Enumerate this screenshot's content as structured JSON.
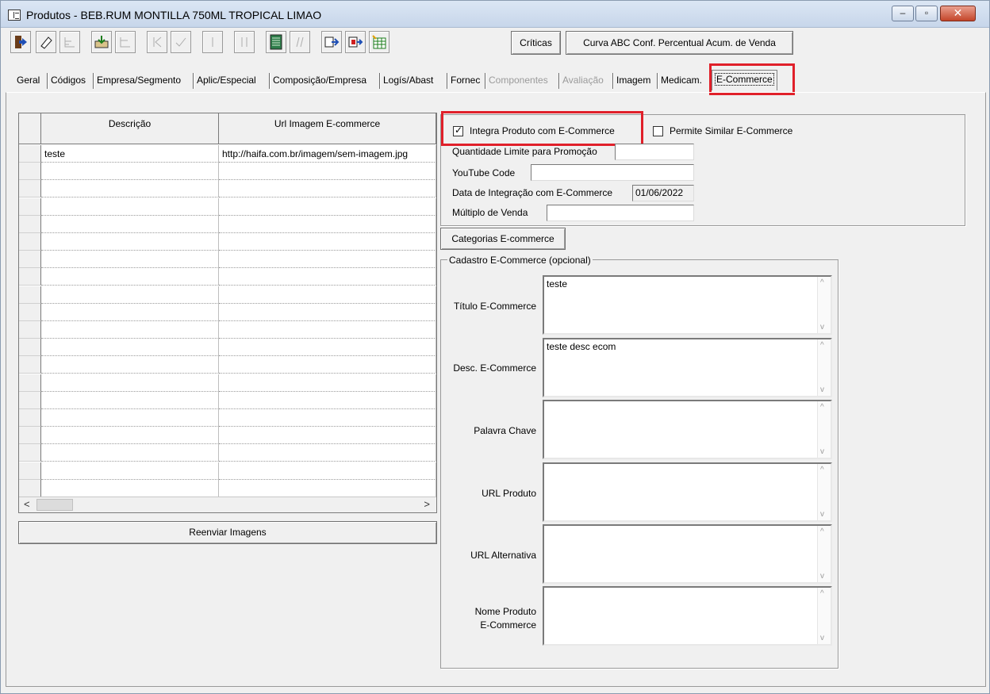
{
  "window": {
    "title": "Produtos - BEB.RUM MONTILLA 750ML TROPICAL LIMAO",
    "controls": {
      "minimize": "–",
      "maximize": "▫",
      "close": "✕"
    }
  },
  "toolbar": {
    "icons": [
      "exit-icon",
      "eraser-icon",
      "tree-icon",
      "save-icon",
      "collapse-icon",
      "first-icon",
      "check-icon",
      "last-icon",
      "pause-icon",
      "ledger-icon",
      "italic-icon",
      "import-icon",
      "export-icon",
      "spreadsheet-icon"
    ],
    "criticas_label": "Críticas",
    "curva_label": "Curva ABC Conf. Percentual Acum. de Venda"
  },
  "tabs": [
    {
      "label": "Geral",
      "enabled": true
    },
    {
      "label": "Códigos",
      "enabled": true
    },
    {
      "label": "Empresa/Segmento",
      "enabled": true
    },
    {
      "label": "Aplic/Especial",
      "enabled": true
    },
    {
      "label": "Composição/Empresa",
      "enabled": true
    },
    {
      "label": "Logís/Abast",
      "enabled": true
    },
    {
      "label": "Fornec",
      "enabled": true
    },
    {
      "label": "Componentes",
      "enabled": false
    },
    {
      "label": "Avaliação",
      "enabled": false
    },
    {
      "label": "Imagem",
      "enabled": true
    },
    {
      "label": "Medicam.",
      "enabled": true
    },
    {
      "label": "E-Commerce",
      "enabled": true,
      "active": true
    }
  ],
  "images_grid": {
    "columns": [
      "Descrição",
      "Url Imagem E-commerce"
    ],
    "rows": [
      [
        "teste",
        "http://haifa.com.br/imagem/sem-imagem.jpg"
      ],
      [
        "",
        ""
      ],
      [
        "",
        ""
      ],
      [
        "",
        ""
      ],
      [
        "",
        ""
      ],
      [
        "",
        ""
      ],
      [
        "",
        ""
      ],
      [
        "",
        ""
      ],
      [
        "",
        ""
      ],
      [
        "",
        ""
      ],
      [
        "",
        ""
      ],
      [
        "",
        ""
      ],
      [
        "",
        ""
      ],
      [
        "",
        ""
      ],
      [
        "",
        ""
      ],
      [
        "",
        ""
      ],
      [
        "",
        ""
      ],
      [
        "",
        ""
      ],
      [
        "",
        ""
      ],
      [
        "",
        ""
      ]
    ],
    "scroll_left": "<",
    "scroll_right": ">",
    "reenviar_label": "Reenviar Imagens"
  },
  "ecommerce": {
    "integra_label": "Integra Produto com E-Commerce",
    "integra_checked": true,
    "check_mark": "✓",
    "permite_similar_label": "Permite Similar E-Commerce",
    "permite_similar_checked": false,
    "qtd_limite_label": "Quantidade Limite para Promoção",
    "qtd_limite_value": "",
    "youtube_label": "YouTube Code",
    "youtube_value": "",
    "data_integracao_label": "Data de Integração com E-Commerce",
    "data_integracao_value": "01/06/2022",
    "multiplo_label": "Múltiplo de Venda",
    "multiplo_value": "",
    "categorias_label": "Categorias E-commerce"
  },
  "cadastro": {
    "legend": "Cadastro E-Commerce (opcional)",
    "titulo_label": "Título E-Commerce",
    "titulo_value": "teste",
    "desc_label": "Desc. E-Commerce",
    "desc_value": "teste desc ecom",
    "palavra_label": "Palavra Chave",
    "palavra_value": "",
    "url_produto_label": "URL Produto",
    "url_produto_value": "",
    "url_alt_label": "URL Alternativa",
    "url_alt_value": "",
    "nome_label_1": "Nome Produto",
    "nome_label_2": "E-Commerce",
    "nome_value": "",
    "scroll_up": "^",
    "scroll_down": "v"
  },
  "colors": {
    "highlight": "#e0202a",
    "face": "#f0f0f0"
  }
}
